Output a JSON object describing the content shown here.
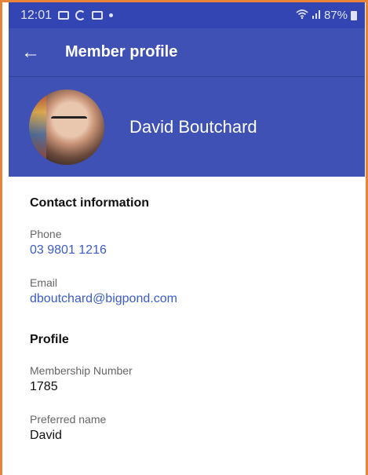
{
  "status_bar": {
    "time": "12:01",
    "battery": "87%",
    "icons": [
      "gallery-icon",
      "sync-icon",
      "mail-icon",
      "dot-icon",
      "wifi-icon",
      "signal-icon",
      "battery-icon"
    ]
  },
  "app_bar": {
    "back_icon": "arrow-left-icon",
    "back_glyph": "←",
    "title": "Member profile"
  },
  "profile_header": {
    "name": "David Boutchard"
  },
  "contact": {
    "heading": "Contact information",
    "phone_label": "Phone",
    "phone_value": "03 9801 1216",
    "email_label": "Email",
    "email_value": "dboutchard@bigpond.com"
  },
  "profile": {
    "heading": "Profile",
    "membership_label": "Membership Number",
    "membership_value": "1785",
    "preferred_label": "Preferred name",
    "preferred_value": "David"
  },
  "colors": {
    "app_bar": "#3f51b5",
    "status_bar": "#3345b3",
    "link": "#3a5ccc",
    "frame_border": "#e8833a"
  }
}
